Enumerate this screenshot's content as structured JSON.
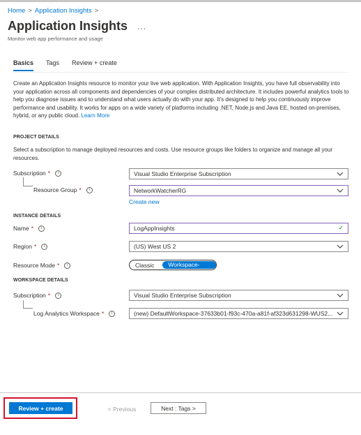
{
  "breadcrumb": {
    "home": "Home",
    "sep1": ">",
    "current": "Application Insights",
    "sep2": ">"
  },
  "header": {
    "title": "Application Insights",
    "more": "...",
    "subtitle": "Monitor web app performance and usage"
  },
  "tabs": [
    {
      "label": "Basics",
      "active": true
    },
    {
      "label": "Tags",
      "active": false
    },
    {
      "label": "Review + create",
      "active": false
    }
  ],
  "description": {
    "text": "Create an Application Insights resource to monitor your live web application. With Application Insights, you have full observability into your application across all components and dependencies of your complex distributed architecture. It includes powerful analytics tools to help you diagnose issues and to understand what users actually do with your app. It's designed to help you continuously improve performance and usability. It works for apps on a wide variety of platforms including .NET, Node.js and Java EE, hosted on-premises, hybrid, or any public cloud.",
    "link": "Learn More"
  },
  "project": {
    "heading": "PROJECT DETAILS",
    "desc": "Select a subscription to manage deployed resources and costs. Use resource groups like folders to organize and manage all your resources.",
    "subscription_label": "Subscription",
    "subscription_value": "Visual Studio Enterprise Subscription",
    "rg_label": "Resource Group",
    "rg_value": "NetworkWatcherRG",
    "create_new": "Create new"
  },
  "instance": {
    "heading": "INSTANCE DETAILS",
    "name_label": "Name",
    "name_value": "LogAppInsights",
    "region_label": "Region",
    "region_value": "(US) West US 2",
    "mode_label": "Resource Mode",
    "mode_classic": "Classic",
    "mode_workspace": "Workspace-based"
  },
  "workspace": {
    "heading": "WORKSPACE DETAILS",
    "subscription_label": "Subscription",
    "subscription_value": "Visual Studio Enterprise Subscription",
    "law_label": "Log Analytics Workspace",
    "law_value": "(new) DefaultWorkspace-37633b01-f93c-470a-a81f-af323d631298-WUS2..."
  },
  "required_mark": "*",
  "info_glyph": "i",
  "footer": {
    "review": "Review + create",
    "previous": "< Previous",
    "next": "Next : Tags >"
  },
  "colors": {
    "accent": "#0078d4",
    "highlight": "#d4112e",
    "required": "#a4262c",
    "active_border": "#8764b8"
  }
}
